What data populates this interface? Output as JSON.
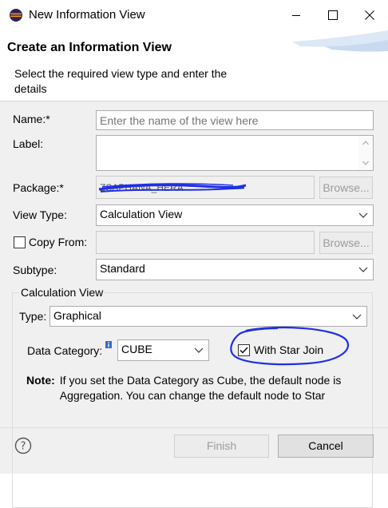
{
  "window": {
    "title": "New Information View",
    "app_icon": "eclipse-icon",
    "minimize_icon": "minimize-icon",
    "maximize_icon": "maximize-icon",
    "close_icon": "close-icon"
  },
  "header": {
    "title": "Create an Information View",
    "description": "Select the required view type and enter the details"
  },
  "form": {
    "name_label": "Name:*",
    "name_placeholder": "Enter the name of the view here",
    "name_value": "",
    "label_label": "Label:",
    "label_value": "",
    "package_label": "Package:*",
    "package_value": "ZSAPHANA_HERA",
    "package_browse": "Browse...",
    "view_type_label": "View Type:",
    "view_type_value": "Calculation View",
    "copy_from_label": "Copy From:",
    "copy_from_checked": false,
    "copy_from_value": "",
    "copy_from_browse": "Browse...",
    "subtype_label": "Subtype:",
    "subtype_value": "Standard"
  },
  "calc_group": {
    "title": "Calculation View",
    "type_label": "Type:",
    "type_value": "Graphical",
    "data_category_label": "Data Category:",
    "data_category_info_icon": "info-icon",
    "data_category_value": "CUBE",
    "star_join_label": "With Star Join",
    "star_join_checked": true,
    "note_label": "Note:",
    "note_text": "If you set the Data Category as Cube, the default node is Aggregation. You can change the default node to Star"
  },
  "footer": {
    "help_icon": "help-icon",
    "finish_label": "Finish",
    "cancel_label": "Cancel"
  },
  "colors": {
    "annotation_blue": "#1f2fe6",
    "background": "#f0f0f0",
    "disabled_text": "#9c9c9c"
  }
}
